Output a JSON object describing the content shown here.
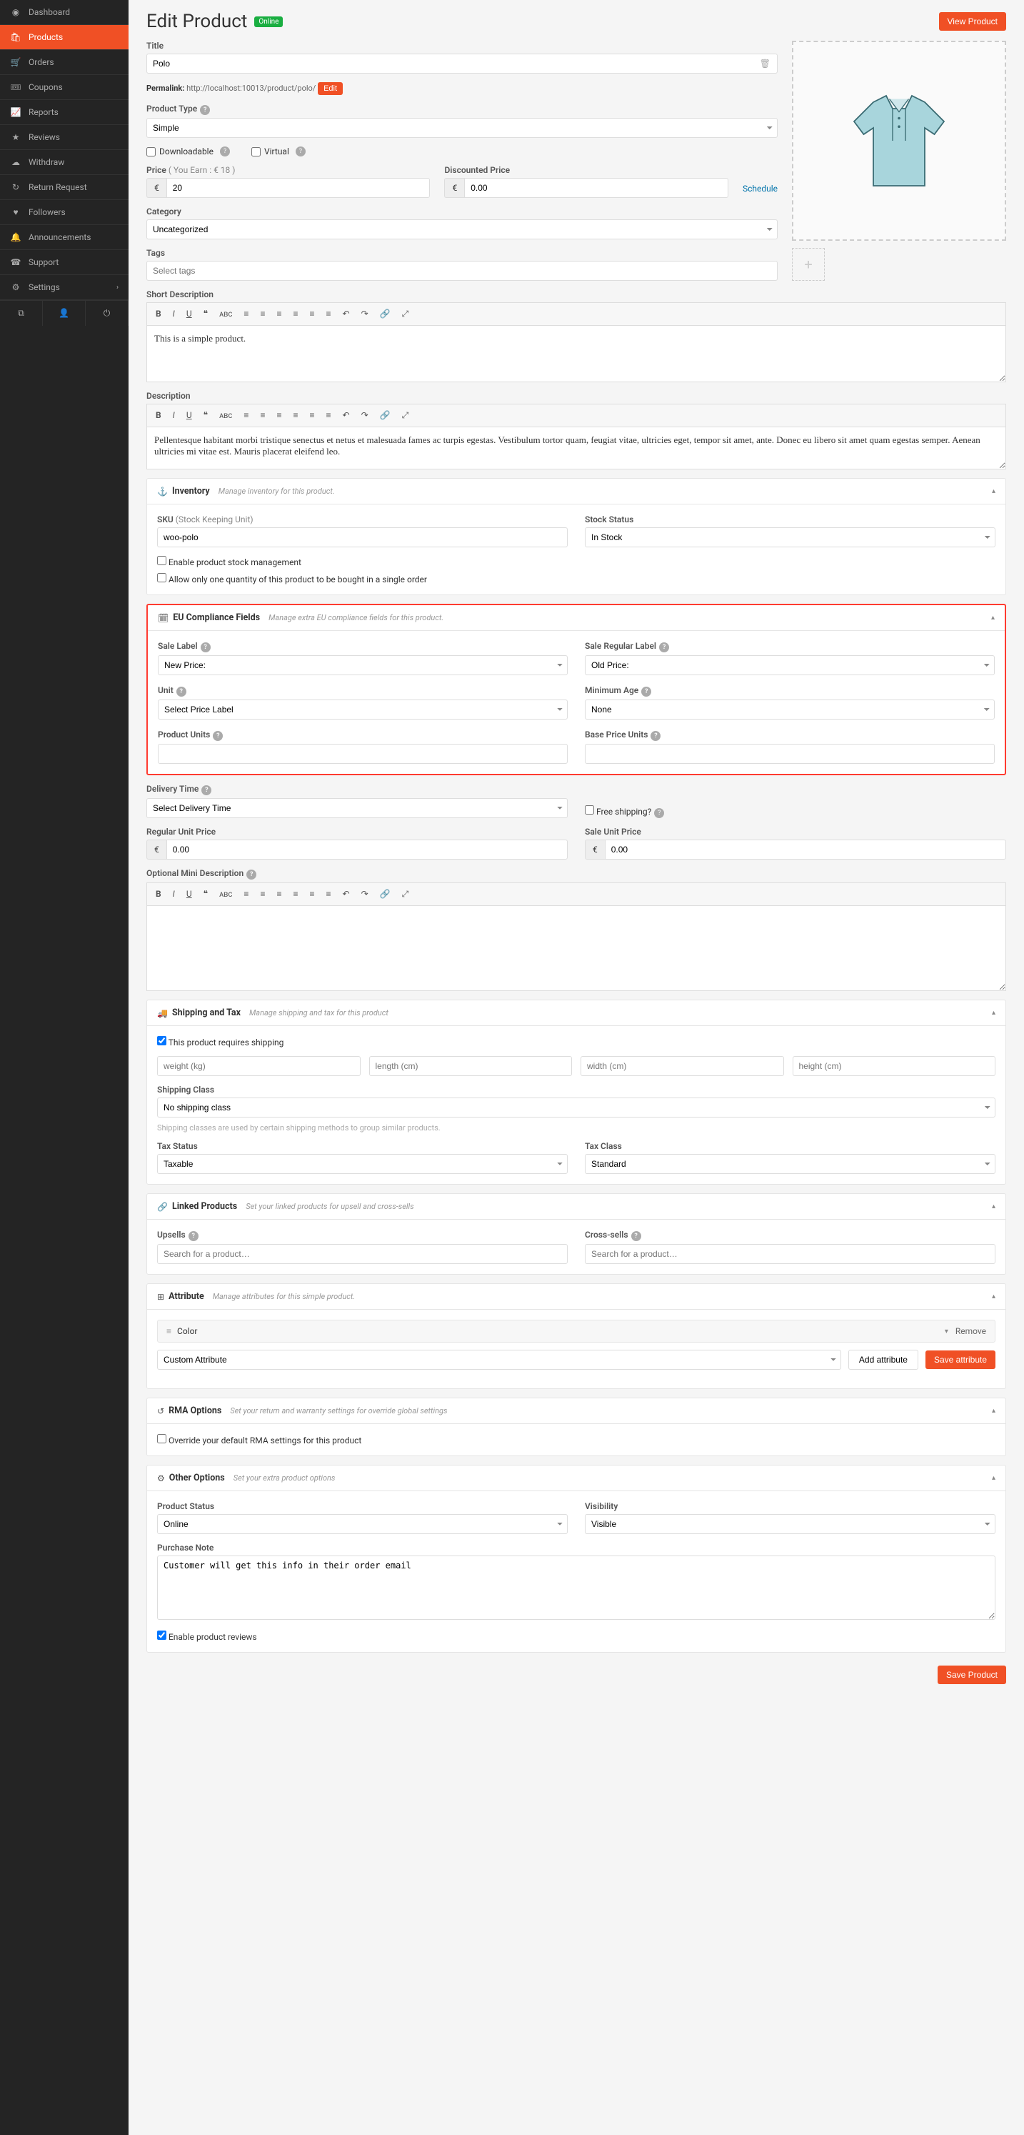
{
  "sidebar": {
    "items": [
      {
        "icon": "◉",
        "label": "Dashboard"
      },
      {
        "icon": "🛍",
        "label": "Products",
        "active": true
      },
      {
        "icon": "🛒",
        "label": "Orders"
      },
      {
        "icon": "🎟",
        "label": "Coupons"
      },
      {
        "icon": "📈",
        "label": "Reports"
      },
      {
        "icon": "★",
        "label": "Reviews"
      },
      {
        "icon": "☁",
        "label": "Withdraw"
      },
      {
        "icon": "↻",
        "label": "Return Request"
      },
      {
        "icon": "♥",
        "label": "Followers"
      },
      {
        "icon": "🔔",
        "label": "Announcements"
      },
      {
        "icon": "☎",
        "label": "Support"
      },
      {
        "icon": "⚙",
        "label": "Settings",
        "chev": "›"
      }
    ]
  },
  "header": {
    "title": "Edit Product",
    "badge": "Online",
    "view": "View Product"
  },
  "form": {
    "title_label": "Title",
    "title": "Polo",
    "permalink_label": "Permalink:",
    "permalink_url": "http://localhost:10013/product/polo/",
    "permalink_edit": "Edit",
    "product_type_label": "Product Type",
    "product_type": "Simple",
    "downloadable": "Downloadable",
    "virtual": "Virtual",
    "price_label": "Price",
    "price_earn": "( You Earn : € 18 )",
    "price": "20",
    "discounted_label": "Discounted Price",
    "discounted": "0.00",
    "schedule": "Schedule",
    "currency": "€",
    "category_label": "Category",
    "category": "Uncategorized",
    "tags_label": "Tags",
    "tags_placeholder": "Select tags",
    "short_desc_label": "Short Description",
    "short_desc_body": "This is a simple product.",
    "desc_label": "Description",
    "desc_body": "Pellentesque habitant morbi tristique senectus et netus et malesuada fames ac turpis egestas. Vestibulum tortor quam, feugiat vitae, ultricies eget, tempor sit amet, ante. Donec eu libero sit amet quam egestas semper. Aenean ultricies mi vitae est. Mauris placerat eleifend leo."
  },
  "inventory": {
    "title": "Inventory",
    "subtitle": "Manage inventory for this product.",
    "sku_label": "SKU",
    "sku_sub": "(Stock Keeping Unit)",
    "sku": "woo-polo",
    "stock_status_label": "Stock Status",
    "stock_status": "In Stock",
    "enable_stock": "Enable product stock management",
    "only_one": "Allow only one quantity of this product to be bought in a single order"
  },
  "eu": {
    "title": "EU Compliance Fields",
    "subtitle": "Manage extra EU compliance fields for this product.",
    "sale_label": "Sale Label",
    "sale_label_value": "New Price:",
    "sale_regular_label": "Sale Regular Label",
    "sale_regular_value": "Old Price:",
    "unit": "Unit",
    "unit_value": "Select Price Label",
    "min_age": "Minimum Age",
    "min_age_value": "None",
    "product_units": "Product Units",
    "base_price_units": "Base Price Units",
    "delivery_time": "Delivery Time",
    "delivery_time_value": "Select Delivery Time",
    "free_shipping": "Free shipping?",
    "regular_unit_price": "Regular Unit Price",
    "regular_unit_price_value": "0.00",
    "sale_unit_price": "Sale Unit Price",
    "sale_unit_price_value": "0.00",
    "optional_mini": "Optional Mini Description"
  },
  "shipping": {
    "title": "Shipping and Tax",
    "subtitle": "Manage shipping and tax for this product",
    "requires": "This product requires shipping",
    "weight": "weight (kg)",
    "length": "length (cm)",
    "width": "width (cm)",
    "height": "height (cm)",
    "ship_class_label": "Shipping Class",
    "ship_class": "No shipping class",
    "note": "Shipping classes are used by certain shipping methods to group similar products.",
    "tax_status_label": "Tax Status",
    "tax_status": "Taxable",
    "tax_class_label": "Tax Class",
    "tax_class": "Standard"
  },
  "linked": {
    "title": "Linked Products",
    "subtitle": "Set your linked products for upsell and cross-sells",
    "upsells": "Upsells",
    "cross": "Cross-sells",
    "search": "Search for a product…"
  },
  "attribute": {
    "title": "Attribute",
    "subtitle": "Manage attributes for this simple product.",
    "color": "Color",
    "remove": "Remove",
    "custom": "Custom Attribute",
    "add": "Add attribute",
    "save": "Save attribute"
  },
  "rma": {
    "title": "RMA Options",
    "subtitle": "Set your return and warranty settings for override global settings",
    "override": "Override your default RMA settings for this product"
  },
  "other": {
    "title": "Other Options",
    "subtitle": "Set your extra product options",
    "status_label": "Product Status",
    "status": "Online",
    "visibility_label": "Visibility",
    "visibility": "Visible",
    "purchase_note_label": "Purchase Note",
    "purchase_note": "Customer will get this info in their order email",
    "enable_reviews": "Enable product reviews"
  },
  "save": "Save Product",
  "toolbar_icons": [
    "B",
    "I",
    "U",
    "❝",
    "ᴀʙᴄ",
    "≡",
    "≡",
    "≡",
    "≡",
    "≡",
    "≡",
    "↶",
    "↷",
    "🔗",
    "⤢"
  ]
}
